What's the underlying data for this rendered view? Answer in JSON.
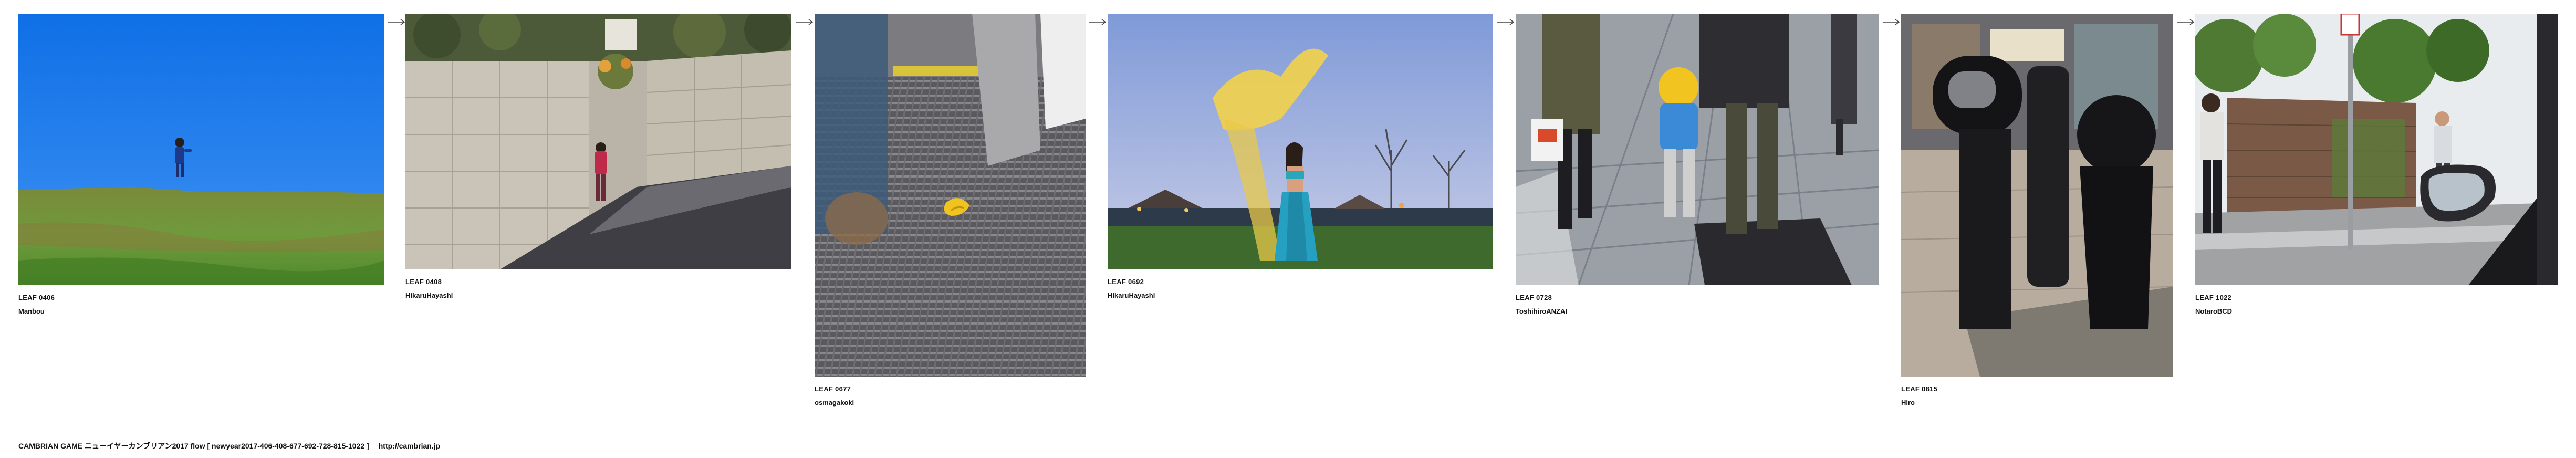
{
  "leaves": [
    {
      "id": "LEAF 0406",
      "author": "Manbou"
    },
    {
      "id": "LEAF 0408",
      "author": "HikaruHayashi"
    },
    {
      "id": "LEAF 0677",
      "author": "osmagakoki"
    },
    {
      "id": "LEAF 0692",
      "author": "HikaruHayashi"
    },
    {
      "id": "LEAF 0728",
      "author": "ToshihiroANZAI"
    },
    {
      "id": "LEAF 0815",
      "author": "Hiro"
    },
    {
      "id": "LEAF 1022",
      "author": "NotaroBCD"
    }
  ],
  "footer": {
    "title": "CAMBRIAN GAME  ニューイヤーカンブリアン2017  flow [ newyear2017-406-408-677-692-728-815-1022 ]",
    "url": "http://cambrian.jp"
  },
  "icons": {
    "arrow": "right-arrow-icon"
  }
}
